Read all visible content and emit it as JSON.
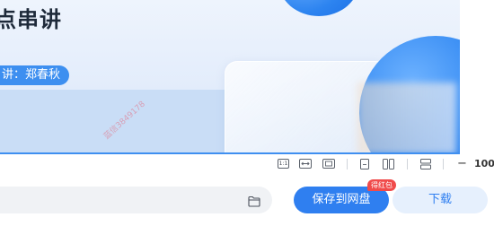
{
  "preview": {
    "title": "点串讲",
    "speaker_label": "讲：郑春秋",
    "watermark": "蓝信3849178"
  },
  "viewer_toolbar": {
    "icons": [
      "actual-size-icon",
      "fit-width-icon",
      "fit-page-icon",
      "single-page-icon",
      "two-page-icon",
      "scroll-mode-icon"
    ],
    "actual_size_label": "1:1",
    "zoom_out_label": "−",
    "zoom_value": "100"
  },
  "action_bar": {
    "path_value": "",
    "save_label": "保存到网盘",
    "badge_label": "得红包",
    "download_label": "下载",
    "accent_color": "#2f7ff0",
    "badge_color": "#f04b4b"
  }
}
